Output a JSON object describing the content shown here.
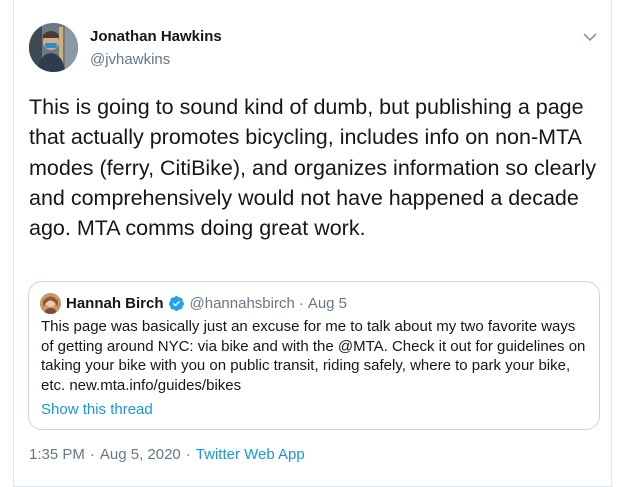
{
  "tweet": {
    "author": {
      "name": "Jonathan Hawkins",
      "handle": "@jvhawkins"
    },
    "text": "This is going to sound kind of dumb, but publishing a page that actually promotes bicycling, includes info on non-MTA modes (ferry, CitiBike), and organizes information so clearly and comprehensively would not have happened a decade ago. MTA comms doing great work.",
    "time": "1:35 PM",
    "date": "Aug 5, 2020",
    "separator": "·",
    "source": "Twitter Web App"
  },
  "quoted_tweet": {
    "author": {
      "name": "Hannah Birch",
      "handle": "@hannahsbirch",
      "verified": true
    },
    "separator": "·",
    "date": "Aug 5",
    "text": "This page was basically just an excuse for me to talk about my two favorite ways of getting around NYC: via bike and with the @MTA. Check it out for guidelines on taking your bike with you on public transit, riding safely, where to park your bike, etc. new.mta.info/guides/bikes",
    "show_thread_label": "Show this thread"
  },
  "icons": {
    "menu": "chevron-down-icon",
    "verified": "verified-badge-icon"
  },
  "colors": {
    "text": "#14171a",
    "secondary": "#657786",
    "link": "#1b95e0",
    "border": "#ccd6dd"
  }
}
